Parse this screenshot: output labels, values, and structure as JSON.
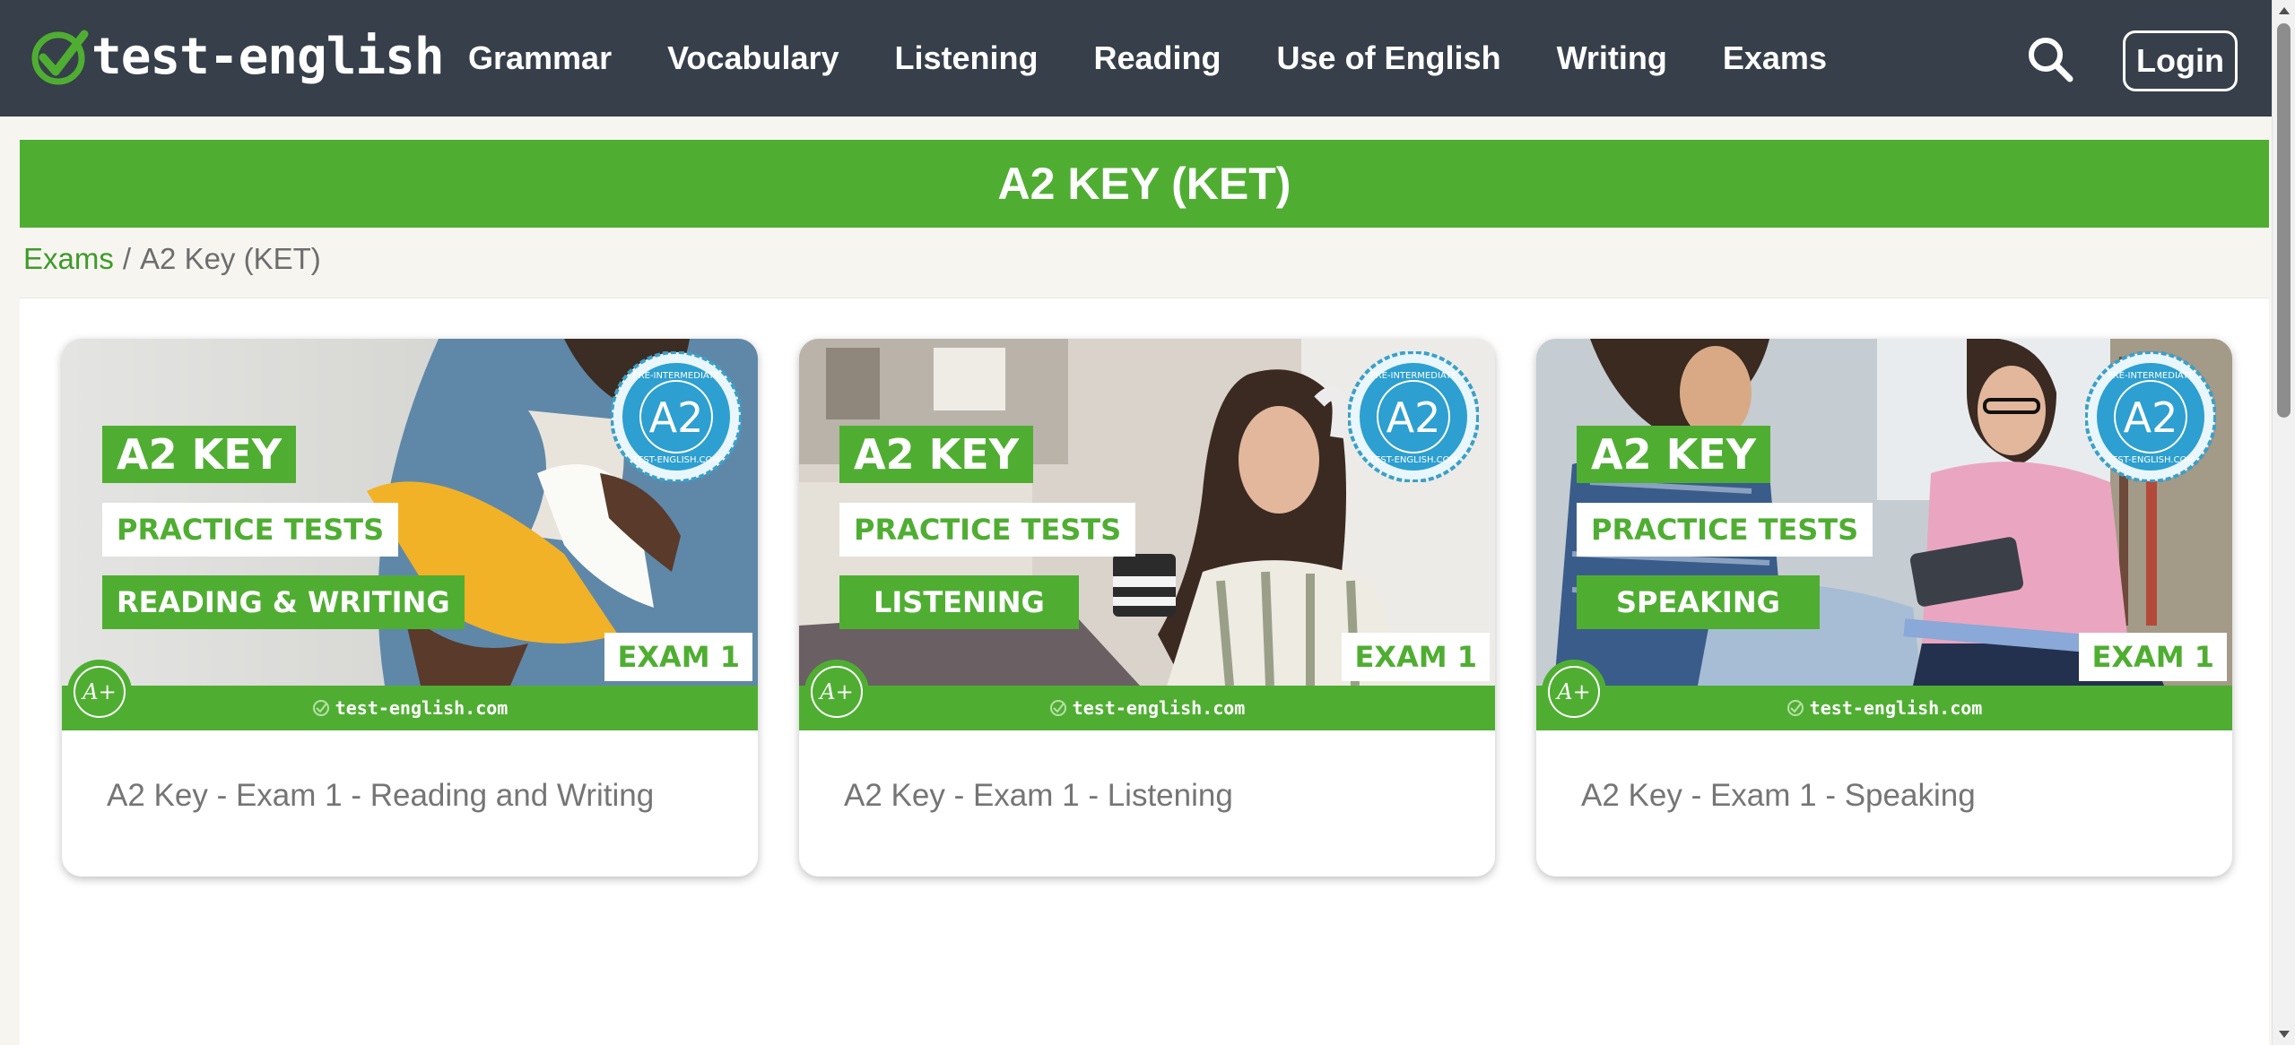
{
  "brand": {
    "logo_text": "test-english",
    "accent_green": "#4fae32",
    "navbar_bg": "#363f4a"
  },
  "nav": {
    "items": [
      {
        "label": "Grammar"
      },
      {
        "label": "Vocabulary"
      },
      {
        "label": "Listening"
      },
      {
        "label": "Reading"
      },
      {
        "label": "Use of English"
      },
      {
        "label": "Writing"
      },
      {
        "label": "Exams"
      }
    ],
    "search_icon": "search-icon",
    "login_label": "Login"
  },
  "page": {
    "title": "A2 KEY (KET)"
  },
  "breadcrumb": {
    "parent": "Exams",
    "separator": "/",
    "current": "A2 Key (KET)"
  },
  "cards": [
    {
      "image": {
        "key_label": "A2 KEY",
        "practice_label": "PRACTICE TESTS",
        "skill_label": "READING & WRITING",
        "exam_label": "EXAM 1",
        "seal_level": "A2",
        "seal_top": "PRE-INTERMEDIATE",
        "seal_bottom": "TEST-ENGLISH.COM",
        "badge_label": "A+",
        "footer_site": "test-english.com"
      },
      "caption": "A2 Key - Exam 1 - Reading and Writing"
    },
    {
      "image": {
        "key_label": "A2 KEY",
        "practice_label": "PRACTICE TESTS",
        "skill_label": "LISTENING",
        "exam_label": "EXAM 1",
        "seal_level": "A2",
        "seal_top": "PRE-INTERMEDIATE",
        "seal_bottom": "TEST-ENGLISH.COM",
        "badge_label": "A+",
        "footer_site": "test-english.com"
      },
      "caption": "A2 Key - Exam 1 - Listening"
    },
    {
      "image": {
        "key_label": "A2 KEY",
        "practice_label": "PRACTICE TESTS",
        "skill_label": "SPEAKING",
        "exam_label": "EXAM 1",
        "seal_level": "A2",
        "seal_top": "PRE-INTERMEDIATE",
        "seal_bottom": "TEST-ENGLISH.COM",
        "badge_label": "A+",
        "footer_site": "test-english.com"
      },
      "caption": "A2 Key - Exam 1 - Speaking"
    }
  ]
}
